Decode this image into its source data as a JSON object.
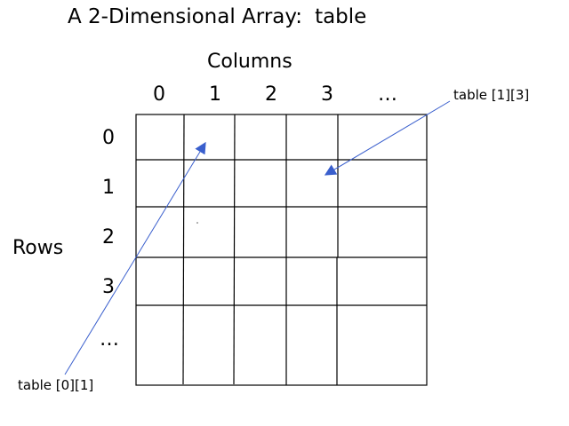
{
  "title": {
    "prefix": "A 2-Dimensional Array:",
    "name": "table"
  },
  "columns": {
    "heading": "Columns",
    "labels": [
      "0",
      "1",
      "2",
      "3",
      "…"
    ]
  },
  "rows": {
    "heading": "Rows",
    "labels": [
      "0",
      "1",
      "2",
      "3",
      "…"
    ]
  },
  "callouts": [
    {
      "text": "table [1][3]"
    },
    {
      "text": "table [0][1]"
    }
  ],
  "colors": {
    "arrow": "#3a5fcd",
    "grid": "#000000"
  }
}
